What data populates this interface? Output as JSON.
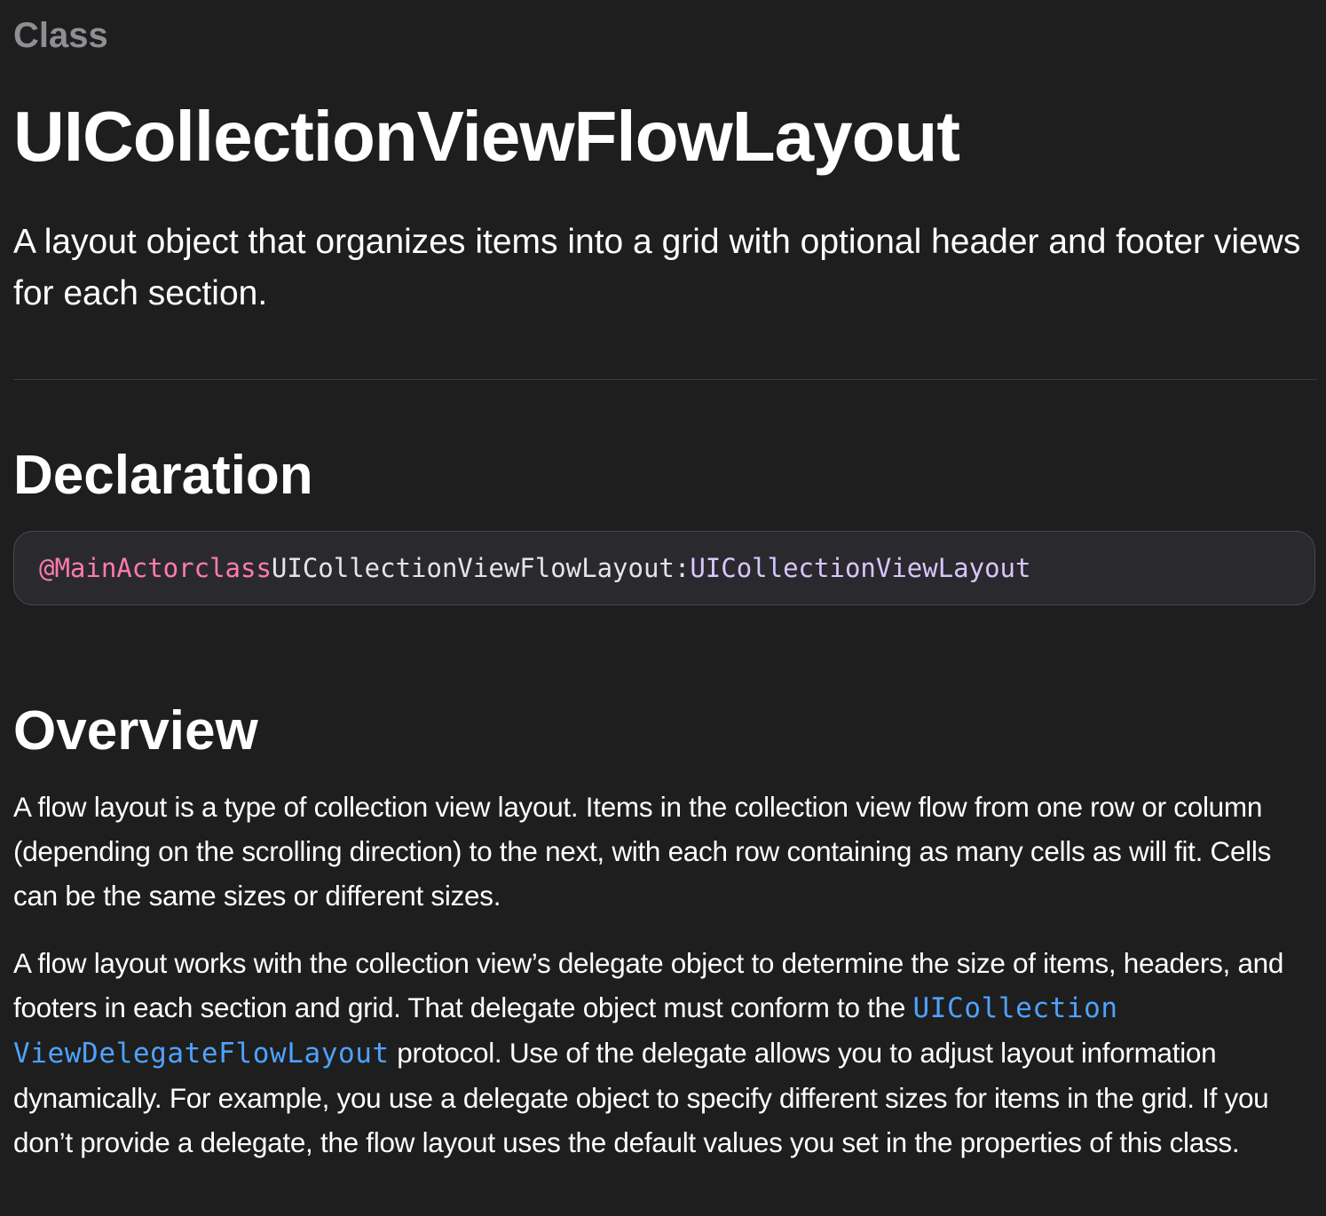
{
  "header": {
    "eyebrow": "Class",
    "title": "UICollectionViewFlowLayout",
    "abstract": "A layout object that organizes items into a grid with optional header and footer views for each section."
  },
  "declaration": {
    "heading": "Declaration",
    "code": {
      "attribute": "@MainActor",
      "keyword": "class",
      "name": "UICollectionViewFlowLayout",
      "separator": ":",
      "superclass": "UICollectionViewLayout"
    }
  },
  "overview": {
    "heading": "Overview",
    "paragraph1": "A flow layout is a type of collection view layout. Items in the collection view flow from one row or column (depending on the scrolling direction) to the next, with each row containing as many cells as will fit. Cells can be the same sizes or different sizes.",
    "paragraph2": {
      "before_link": "A flow layout works with the collection view’s delegate object to determine the size of items, headers, and footers in each section and grid. That delegate object must conform to the ",
      "link_part1": "UICollection",
      "link_part2": "ViewDelegateFlowLayout",
      "after_link": " protocol. Use of the delegate allows you to adjust layout information dynamically. For example, you use a delegate object to specify different sizes for items in the grid. If you don’t provide a delegate, the flow layout uses the default values you set in the properties of this class."
    }
  },
  "colors": {
    "background": "#1e1e1e",
    "eyebrow": "#8e8e93",
    "code_keyword": "#ff7ab2",
    "code_type": "#d8c6ff",
    "link": "#4ea2ff"
  }
}
